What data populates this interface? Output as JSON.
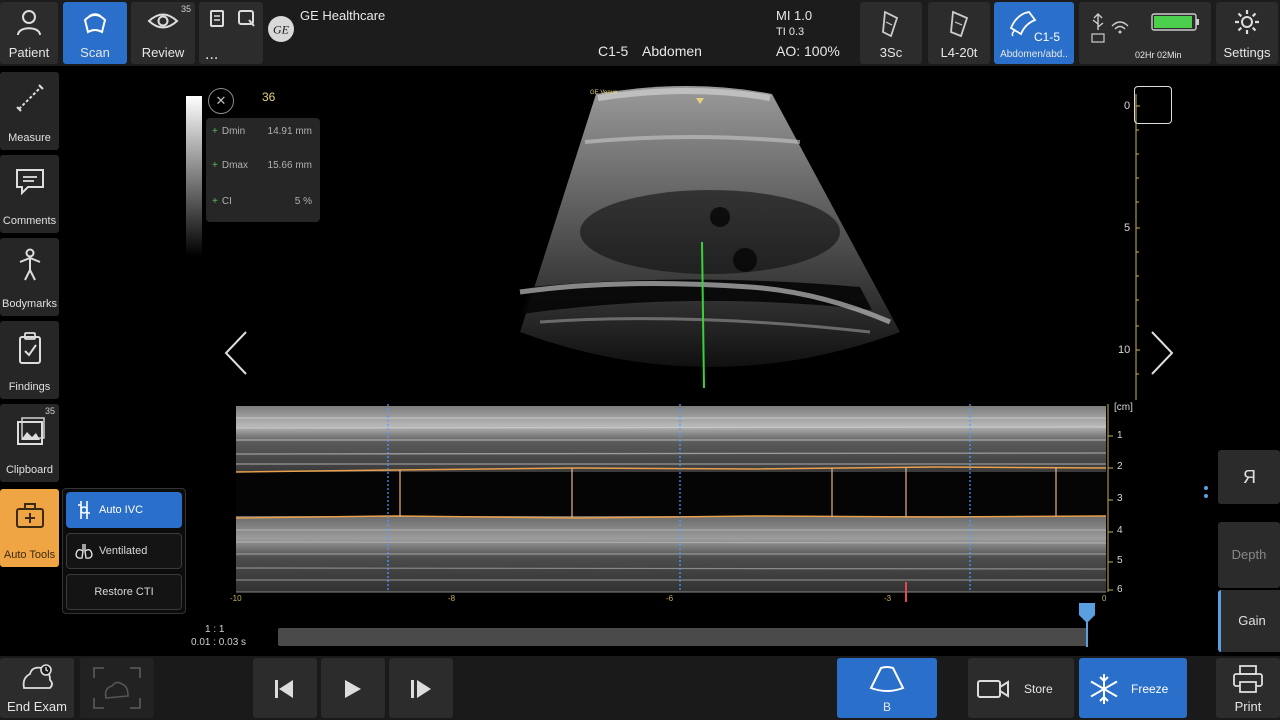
{
  "topbar": {
    "patient_label": "Patient",
    "scan_label": "Scan",
    "review_label": "Review",
    "review_count": "35",
    "more_label": "...",
    "brand": "GE Healthcare",
    "brand_logo_text": "GE",
    "probe_info": "C1-5",
    "preset": "Abdomen",
    "mi": "MI 1.0",
    "ti": "TI 0.3",
    "ao": "AO: 100%",
    "probe1": "3Sc",
    "probe2": "L4-20t",
    "probe3_title": "C1-5",
    "probe3_sub": "Abdomen/abd..",
    "battery_time": "02Hr 02Min",
    "settings_label": "Settings"
  },
  "left": {
    "measure": "Measure",
    "comments": "Comments",
    "bodymarks": "Bodymarks",
    "findings": "Findings",
    "clipboard": "Clipboard",
    "clipboard_count": "35",
    "autotools": "Auto Tools",
    "sub_autoivc": "Auto IVC",
    "sub_ventilated": "Ventilated",
    "sub_restore": "Restore CTI"
  },
  "image": {
    "frame_number": "36",
    "measurements": [
      {
        "label": "Dmin",
        "value": "14.91 mm"
      },
      {
        "label": "Dmax",
        "value": "15.66 mm"
      },
      {
        "label": "CI",
        "value": "5 %"
      }
    ],
    "orientation_mark": "GE Venue",
    "depth_ticks": [
      "0",
      "5",
      "10"
    ],
    "mmode_unit": "[cm]",
    "mmode_ticks": [
      "1",
      "2",
      "3",
      "4",
      "5",
      "6"
    ],
    "time_ticks": [
      "-10",
      "-8",
      "-6",
      "-3",
      "0"
    ],
    "cine_ratio": "1 : 1",
    "cine_time": "0.01 : 0.03 s"
  },
  "right": {
    "r_label": "R",
    "depth": "Depth",
    "gain": "Gain"
  },
  "bottom": {
    "end_exam": "End Exam",
    "b_mode": "B",
    "store": "Store",
    "freeze": "Freeze",
    "print": "Print"
  },
  "colors": {
    "accent": "#2a6fc9",
    "autotools": "#f0a545",
    "measure_line": "#e8a04a",
    "caliper": "#39d039",
    "cursor_line": "#4aa0ff"
  }
}
